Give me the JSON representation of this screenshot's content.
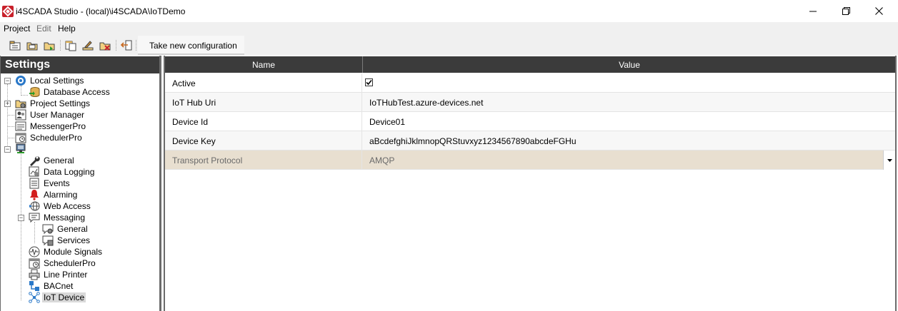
{
  "window": {
    "title": "i4SCADA Studio - (local)\\i4SCADA\\IoTDemo"
  },
  "menu": {
    "project": "Project",
    "edit": "Edit",
    "help": "Help"
  },
  "toolbar": {
    "take_config_label": "Take new configuration",
    "icons": [
      "new-project-icon",
      "open-project-icon",
      "import-icon",
      "copy-icon",
      "upload-icon",
      "delete-icon",
      "exit-icon"
    ]
  },
  "settings_panel": {
    "header": "Settings",
    "items": [
      {
        "label": "Local Settings",
        "icon": "gear-icon"
      },
      {
        "label": "Database Access",
        "icon": "database-icon"
      },
      {
        "label": "Project Settings",
        "icon": "project-settings-icon"
      },
      {
        "label": "User Manager",
        "icon": "user-manager-icon"
      },
      {
        "label": "MessengerPro",
        "icon": "messenger-icon"
      },
      {
        "label": "SchedulerPro",
        "icon": "scheduler-icon"
      },
      {
        "label": "",
        "icon": "computer-icon"
      },
      {
        "label": "General",
        "icon": "wrench-icon"
      },
      {
        "label": "Data Logging",
        "icon": "data-logging-icon"
      },
      {
        "label": "Events",
        "icon": "events-icon"
      },
      {
        "label": "Alarming",
        "icon": "alarm-bell-icon"
      },
      {
        "label": "Web Access",
        "icon": "web-access-icon"
      },
      {
        "label": "Messaging",
        "icon": "messaging-icon"
      },
      {
        "label": "General",
        "icon": "messaging-general-icon"
      },
      {
        "label": "Services",
        "icon": "messaging-services-icon"
      },
      {
        "label": "Module Signals",
        "icon": "module-signals-icon"
      },
      {
        "label": "SchedulerPro",
        "icon": "scheduler-icon"
      },
      {
        "label": "Line Printer",
        "icon": "printer-icon"
      },
      {
        "label": "BACnet",
        "icon": "bacnet-icon"
      },
      {
        "label": "IoT Device",
        "icon": "iot-device-icon"
      }
    ]
  },
  "grid": {
    "columns": {
      "name": "Name",
      "value": "Value"
    },
    "rows": [
      {
        "name": "Active",
        "value": "",
        "checked": true
      },
      {
        "name": "IoT Hub Uri",
        "value": "IoTHubTest.azure-devices.net"
      },
      {
        "name": "Device Id",
        "value": "Device01"
      },
      {
        "name": "Device Key",
        "value": "aBcdefghiJklmnopQRStuvxyz1234567890abcdeFGHu"
      },
      {
        "name": "Transport Protocol",
        "value": "AMQP"
      }
    ]
  },
  "colors": {
    "accent": "#c8202a",
    "header_bg": "#3b3b3b",
    "selected_row": "#e8dfd0"
  }
}
